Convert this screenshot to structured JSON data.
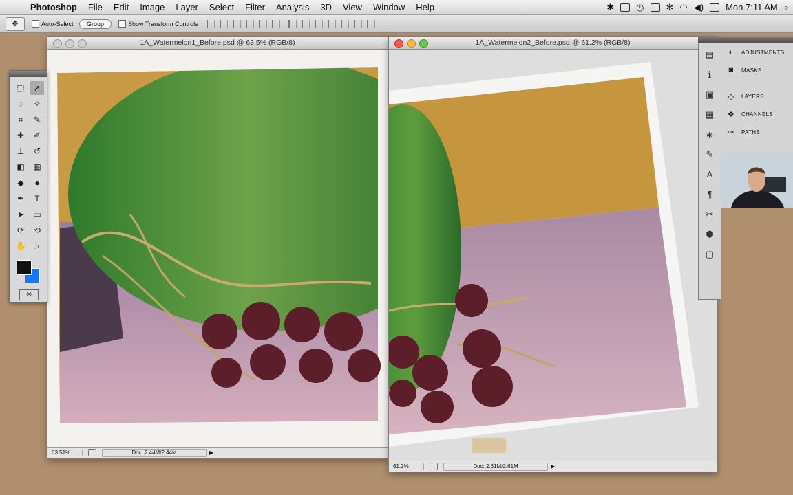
{
  "menubar": {
    "apple": "",
    "items": [
      "Photoshop",
      "File",
      "Edit",
      "Image",
      "Layer",
      "Select",
      "Filter",
      "Analysis",
      "3D",
      "View",
      "Window",
      "Help"
    ],
    "clock": "Mon 7:11 AM"
  },
  "options": {
    "auto_select": "Auto-Select:",
    "group_select": "Group",
    "show_transform": "Show Transform Controls"
  },
  "windows": [
    {
      "title": "1A_Watermelon1_Before.psd @ 63.5% (RGB/8)",
      "zoom": "63.51%",
      "doc": "Doc: 2.44M/2.44M"
    },
    {
      "title": "1A_Watermelon2_Before.psd @ 61.2% (RGB/8)",
      "zoom": "61.2%",
      "doc": "Doc: 2.61M/2.61M"
    }
  ],
  "panels": {
    "items": [
      "ADJUSTMENTS",
      "MASKS",
      "LAYERS",
      "CHANNELS",
      "PATHS"
    ]
  },
  "toolbox": {
    "tools": [
      "marquee",
      "move",
      "lasso",
      "magic-wand",
      "crop",
      "eyedropper",
      "healing",
      "brush",
      "stamp",
      "history-brush",
      "eraser",
      "gradient",
      "blur",
      "dodge",
      "pen",
      "type",
      "path-select",
      "shape",
      "3d-rotate",
      "3d-orbit",
      "hand",
      "zoom"
    ],
    "fg_color": "#111111",
    "bg_color": "#1976ff"
  },
  "colors": {
    "desktop": "#b08f6e",
    "watermelon": "#3f8f3a",
    "backdrop": "#c79a3f",
    "table": "#b58d9a",
    "grapes": "#5a1e28"
  }
}
